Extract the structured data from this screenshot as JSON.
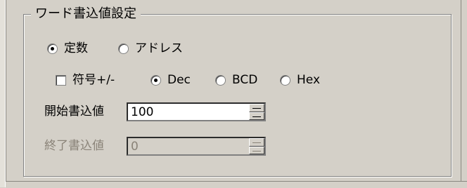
{
  "group": {
    "title": "ワード書込値設定"
  },
  "mode": {
    "constant_label": "定数",
    "address_label": "アドレス"
  },
  "format": {
    "signed_label": "符号+/-",
    "dec_label": "Dec",
    "bcd_label": "BCD",
    "hex_label": "Hex"
  },
  "start_value": {
    "label": "開始書込値",
    "value": "100"
  },
  "end_value": {
    "label": "終了書込値",
    "value": "0"
  }
}
